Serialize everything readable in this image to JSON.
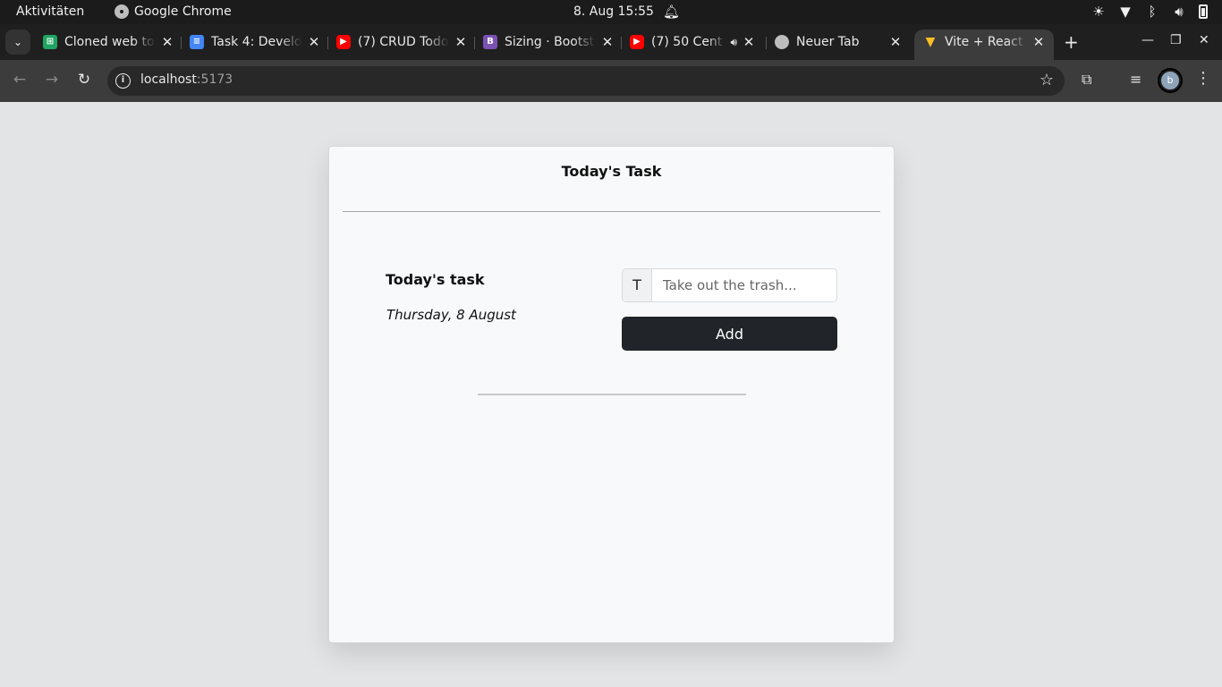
{
  "system_bar": {
    "activities": "Aktivitäten",
    "app_name": "Google Chrome",
    "clock": "8. Aug  15:55"
  },
  "tabs": [
    {
      "title": "Cloned web to",
      "favicon": "sheets-icon",
      "color": "#1fa463"
    },
    {
      "title": "Task 4: Develo",
      "favicon": "docs-icon",
      "color": "#4285f4"
    },
    {
      "title": "(7) CRUD Todo",
      "favicon": "youtube-icon",
      "color": "#ff0000"
    },
    {
      "title": "Sizing · Bootst",
      "favicon": "bootstrap-icon",
      "color": "#7952b3"
    },
    {
      "title": "(7) 50 Cent",
      "favicon": "youtube-icon",
      "color": "#ff0000",
      "audio": true
    },
    {
      "title": "Neuer Tab",
      "favicon": "chrome-icon",
      "color": "#bdbdbd"
    },
    {
      "title": "Vite + React +",
      "favicon": "vite-icon",
      "color": "#a855f7",
      "active": true
    }
  ],
  "address_bar": {
    "host": "localhost",
    "port": ":5173"
  },
  "card": {
    "title": "Today's Task",
    "task_heading": "Today's task",
    "date": "Thursday, 8 August",
    "input_prefix": "T",
    "input_placeholder": "Take out the trash...",
    "input_value": "",
    "add_label": "Add"
  },
  "colors": {
    "page_bg": "#e3e4e6",
    "card_bg": "#f8f9fa",
    "button_bg": "#212529",
    "chrome_frame": "#1f1f1f",
    "chrome_toolbar": "#3c3c3c"
  }
}
